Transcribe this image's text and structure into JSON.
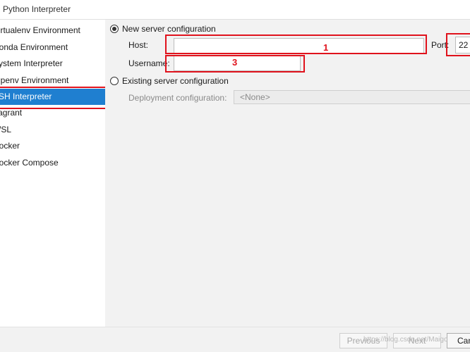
{
  "window": {
    "title": "d Python Interpreter"
  },
  "sidebar": {
    "items": [
      {
        "label": "Virtualenv Environment"
      },
      {
        "label": "Conda Environment"
      },
      {
        "label": "System Interpreter"
      },
      {
        "label": "Pipenv Environment"
      },
      {
        "label": "SSH Interpreter"
      },
      {
        "label": "Vagrant"
      },
      {
        "label": "WSL"
      },
      {
        "label": "Docker"
      },
      {
        "label": "Docker Compose"
      }
    ]
  },
  "main": {
    "new_server": {
      "label": "New server configuration",
      "host_label": "Host:",
      "host_value": "",
      "port_label": "Port:",
      "port_value": "22",
      "username_label": "Username:",
      "username_value": ""
    },
    "existing_server": {
      "label": "Existing server configuration",
      "deployment_label": "Deployment configuration:",
      "deployment_value": "<None>"
    }
  },
  "annotations": {
    "n1": "1",
    "n3": "3",
    "color": "#e0121c"
  },
  "footer": {
    "previous_label": "Previous",
    "next_label": "Next",
    "cancel_label": "Can",
    "watermark": "https://blog.csdn.net/Maigo"
  },
  "colors": {
    "selection": "#1f7fd0",
    "annotation": "#e0121c"
  }
}
